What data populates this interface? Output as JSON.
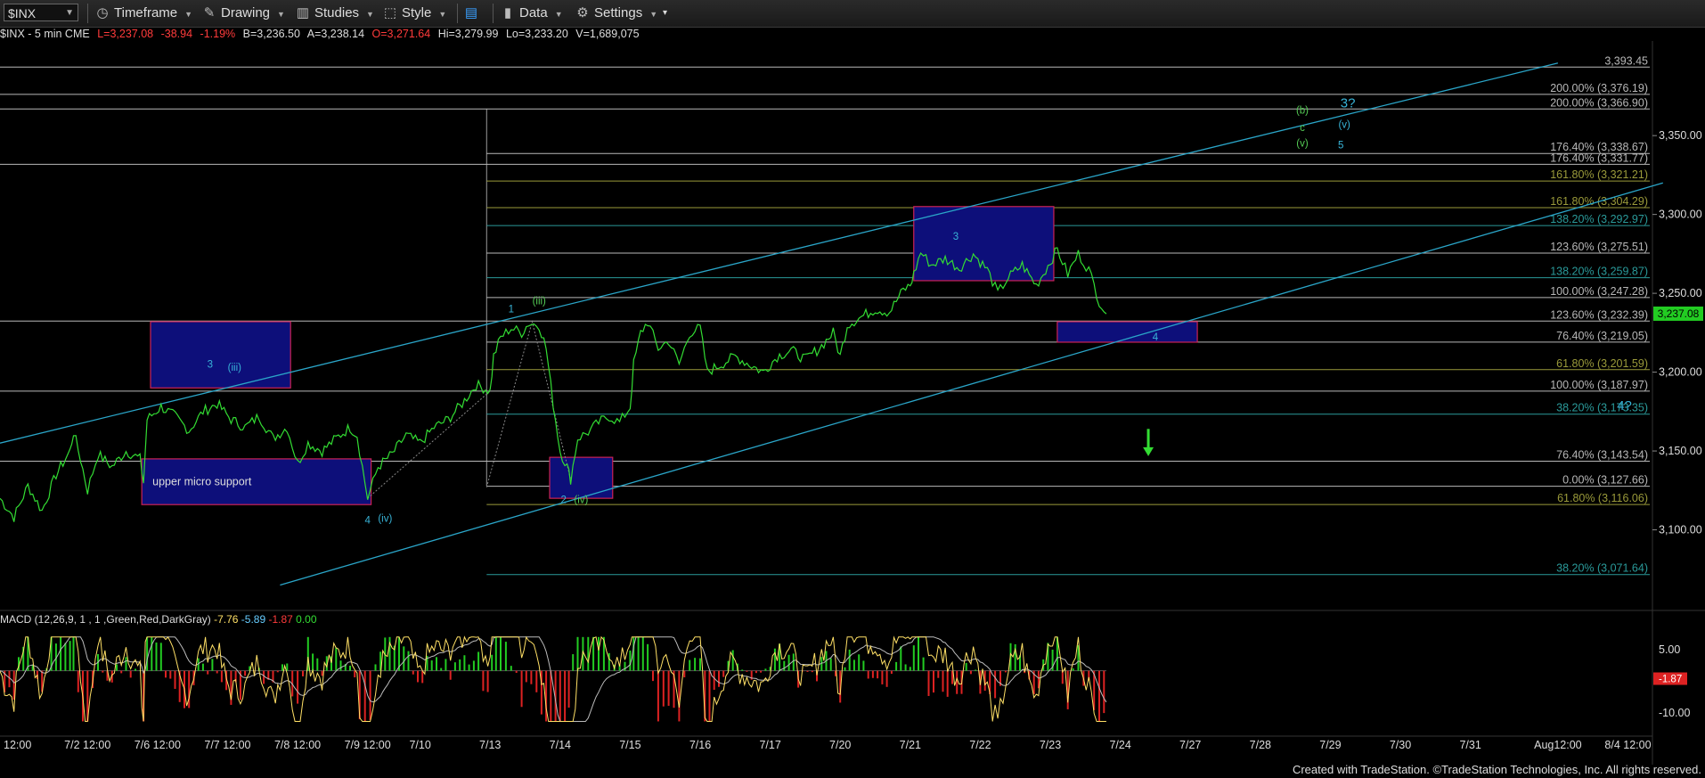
{
  "toolbar": {
    "symbol": "$INX",
    "timeframe": "Timeframe",
    "drawing": "Drawing",
    "studies": "Studies",
    "style": "Style",
    "data": "Data",
    "settings": "Settings"
  },
  "info": {
    "name": "$INX - 5 min  CME",
    "last": "L=3,237.08",
    "change": "-38.94",
    "change_pct": "-1.19%",
    "bid": "B=3,236.50",
    "ask": "A=3,238.14",
    "open": "O=3,271.64",
    "high": "Hi=3,279.99",
    "low": "Lo=3,233.20",
    "volume": "V=1,689,075"
  },
  "macd": {
    "label": "MACD (12,26,9, 1 , 1 ,Green,Red,DarkGray)",
    "v1": "-7.76",
    "v2": "-5.89",
    "v3": "-1.87",
    "v4": "0.00",
    "scale_top": "5.00",
    "scale_bottom": "-10.00",
    "current_tag": "-1.87"
  },
  "colors": {
    "price": "#33dd33",
    "channel": "#2aa5c8",
    "box_fill": "#0d0f7a",
    "box_border": "#cc2255",
    "fib_line": "#b8b8b8",
    "fib_olive": "#9a9a3a",
    "wave_cyan": "#38b4d8",
    "wave_green": "#55cc55",
    "macd_line": "#ffe066"
  },
  "chart_data": {
    "type": "line",
    "symbol": "$INX",
    "interval": "5 min",
    "y_axis": {
      "range": [
        3050,
        3410
      ],
      "ticks": [
        "3,100.00",
        "3,150.00",
        "3,200.00",
        "3,250.00",
        "3,300.00",
        "3,350.00"
      ],
      "tick_values": [
        3100,
        3150,
        3200,
        3250,
        3300,
        3350
      ]
    },
    "x_labels": [
      "12:00",
      "7/2 12:00",
      "7/6 12:00",
      "7/7 12:00",
      "7/8 12:00",
      "7/9 12:00",
      "7/10",
      "7/13",
      "7/14",
      "7/15",
      "7/16",
      "7/17",
      "7/20",
      "7/21",
      "7/22",
      "7/23",
      "7/24",
      "7/27",
      "7/28",
      "7/29",
      "7/30",
      "7/31",
      "Aug12:00",
      "8/4 12:00"
    ],
    "x_label_pos": [
      0.5,
      2.5,
      4.5,
      6.5,
      8.5,
      10.5,
      12,
      14,
      16,
      18,
      20,
      22,
      24,
      26,
      28,
      30,
      32,
      34,
      36,
      38,
      40,
      42,
      44.5,
      46.5
    ],
    "last_price": "3,237.08",
    "last_price_value": 3237.08,
    "series": [
      {
        "values": [
          {
            "x": 0,
            "y": 3120
          },
          {
            "x": 0.4,
            "y": 3108
          },
          {
            "x": 0.8,
            "y": 3128
          },
          {
            "x": 1.2,
            "y": 3112
          },
          {
            "x": 1.6,
            "y": 3135
          },
          {
            "x": 2,
            "y": 3150
          },
          {
            "x": 2.1,
            "y": 3162
          },
          {
            "x": 2.3,
            "y": 3145
          },
          {
            "x": 2.5,
            "y": 3125
          },
          {
            "x": 2.8,
            "y": 3148
          },
          {
            "x": 3.2,
            "y": 3140
          },
          {
            "x": 3.6,
            "y": 3150
          },
          {
            "x": 4,
            "y": 3145
          },
          {
            "x": 4.1,
            "y": 3130
          },
          {
            "x": 4.2,
            "y": 3170
          },
          {
            "x": 4.6,
            "y": 3178
          },
          {
            "x": 5,
            "y": 3172
          },
          {
            "x": 5.4,
            "y": 3163
          },
          {
            "x": 5.8,
            "y": 3175
          },
          {
            "x": 6.2,
            "y": 3180
          },
          {
            "x": 6.6,
            "y": 3170
          },
          {
            "x": 7,
            "y": 3165
          },
          {
            "x": 7.4,
            "y": 3172
          },
          {
            "x": 7.8,
            "y": 3158
          },
          {
            "x": 8.2,
            "y": 3165
          },
          {
            "x": 8.5,
            "y": 3142
          },
          {
            "x": 8.8,
            "y": 3155
          },
          {
            "x": 9.2,
            "y": 3150
          },
          {
            "x": 9.6,
            "y": 3158
          },
          {
            "x": 10,
            "y": 3165
          },
          {
            "x": 10.2,
            "y": 3160
          },
          {
            "x": 10.5,
            "y": 3120
          },
          {
            "x": 10.8,
            "y": 3140
          },
          {
            "x": 11.2,
            "y": 3148
          },
          {
            "x": 11.6,
            "y": 3160
          },
          {
            "x": 12,
            "y": 3155
          },
          {
            "x": 12.4,
            "y": 3165
          },
          {
            "x": 12.8,
            "y": 3170
          },
          {
            "x": 13.2,
            "y": 3180
          },
          {
            "x": 13.6,
            "y": 3192
          },
          {
            "x": 14,
            "y": 3188
          },
          {
            "x": 14.1,
            "y": 3210
          },
          {
            "x": 14.3,
            "y": 3222
          },
          {
            "x": 14.6,
            "y": 3228
          },
          {
            "x": 14.9,
            "y": 3225
          },
          {
            "x": 15.1,
            "y": 3231
          },
          {
            "x": 15.4,
            "y": 3230
          },
          {
            "x": 15.6,
            "y": 3215
          },
          {
            "x": 15.8,
            "y": 3180
          },
          {
            "x": 16,
            "y": 3150
          },
          {
            "x": 16.2,
            "y": 3140
          },
          {
            "x": 16.3,
            "y": 3132
          },
          {
            "x": 16.5,
            "y": 3158
          },
          {
            "x": 16.8,
            "y": 3162
          },
          {
            "x": 17.1,
            "y": 3168
          },
          {
            "x": 17.4,
            "y": 3172
          },
          {
            "x": 17.7,
            "y": 3168
          },
          {
            "x": 18,
            "y": 3178
          },
          {
            "x": 18.1,
            "y": 3205
          },
          {
            "x": 18.3,
            "y": 3225
          },
          {
            "x": 18.5,
            "y": 3232
          },
          {
            "x": 18.8,
            "y": 3215
          },
          {
            "x": 19.1,
            "y": 3220
          },
          {
            "x": 19.4,
            "y": 3205
          },
          {
            "x": 19.7,
            "y": 3225
          },
          {
            "x": 20,
            "y": 3228
          },
          {
            "x": 20.2,
            "y": 3200
          },
          {
            "x": 20.6,
            "y": 3205
          },
          {
            "x": 21,
            "y": 3210
          },
          {
            "x": 21.4,
            "y": 3205
          },
          {
            "x": 21.8,
            "y": 3200
          },
          {
            "x": 22.2,
            "y": 3210
          },
          {
            "x": 22.6,
            "y": 3214
          },
          {
            "x": 23,
            "y": 3208
          },
          {
            "x": 23.4,
            "y": 3215
          },
          {
            "x": 23.8,
            "y": 3225
          },
          {
            "x": 24,
            "y": 3210
          },
          {
            "x": 24.2,
            "y": 3230
          },
          {
            "x": 24.6,
            "y": 3235
          },
          {
            "x": 25,
            "y": 3240
          },
          {
            "x": 25.4,
            "y": 3238
          },
          {
            "x": 25.8,
            "y": 3252
          },
          {
            "x": 26,
            "y": 3255
          },
          {
            "x": 26.1,
            "y": 3262
          },
          {
            "x": 26.3,
            "y": 3276
          },
          {
            "x": 26.6,
            "y": 3268
          },
          {
            "x": 27,
            "y": 3272
          },
          {
            "x": 27.4,
            "y": 3266
          },
          {
            "x": 27.8,
            "y": 3275
          },
          {
            "x": 28.2,
            "y": 3265
          },
          {
            "x": 28.5,
            "y": 3250
          },
          {
            "x": 28.8,
            "y": 3260
          },
          {
            "x": 29.2,
            "y": 3268
          },
          {
            "x": 29.6,
            "y": 3255
          },
          {
            "x": 30,
            "y": 3270
          },
          {
            "x": 30.2,
            "y": 3278
          },
          {
            "x": 30.5,
            "y": 3262
          },
          {
            "x": 30.8,
            "y": 3275
          },
          {
            "x": 31.1,
            "y": 3265
          },
          {
            "x": 31.4,
            "y": 3245
          },
          {
            "x": 31.6,
            "y": 3237
          }
        ]
      }
    ],
    "horizontal_levels": [
      {
        "label": "3,393.45",
        "value": 3393.45,
        "color": "#b8b8b8"
      },
      {
        "label": "200.00% (3,376.19)",
        "value": 3376.19,
        "color": "#b8b8b8"
      },
      {
        "label": "200.00% (3,366.90)",
        "value": 3366.9,
        "color": "#b8b8b8"
      },
      {
        "label": "176.40% (3,338.67)",
        "value": 3338.67,
        "color": "#b8b8b8"
      },
      {
        "label": "176.40% (3,331.77)",
        "value": 3331.77,
        "color": "#b8b8b8"
      },
      {
        "label": "161.80% (3,321.21)",
        "value": 3321.21,
        "color": "#9a9a3a"
      },
      {
        "label": "161.80% (3,304.29)",
        "value": 3304.29,
        "color": "#9a9a3a"
      },
      {
        "label": "138.20% (3,292.97)",
        "value": 3292.97,
        "color": "#2a9a9a"
      },
      {
        "label": "123.60% (3,275.51)",
        "value": 3275.51,
        "color": "#b8b8b8"
      },
      {
        "label": "138.20% (3,259.87)",
        "value": 3259.87,
        "color": "#2a9a9a"
      },
      {
        "label": "100.00% (3,247.28)",
        "value": 3247.28,
        "color": "#b8b8b8"
      },
      {
        "label": "123.60% (3,232.39)",
        "value": 3232.39,
        "color": "#b8b8b8"
      },
      {
        "label": "76.40% (3,219.05)",
        "value": 3219.05,
        "color": "#b8b8b8"
      },
      {
        "label": "61.80% (3,201.59)",
        "value": 3201.59,
        "color": "#9a9a3a"
      },
      {
        "label": "100.00% (3,187.97)",
        "value": 3187.97,
        "color": "#b8b8b8"
      },
      {
        "label": "38.20% (3,173.35)",
        "value": 3173.35,
        "color": "#2a9a9a"
      },
      {
        "label": "76.40% (3,143.54)",
        "value": 3143.54,
        "color": "#b8b8b8"
      },
      {
        "label": "0.00% (3,127.66)",
        "value": 3127.66,
        "color": "#b8b8b8"
      },
      {
        "label": "61.80% (3,116.06)",
        "value": 3116.06,
        "color": "#9a9a3a"
      },
      {
        "label": "38.20% (3,071.64)",
        "value": 3071.64,
        "color": "#2a9a9a"
      }
    ],
    "boxes": [
      {
        "x0": 4.3,
        "x1": 8.3,
        "y0": 3190,
        "y1": 3232,
        "label": ""
      },
      {
        "x0": 4.05,
        "x1": 10.6,
        "y0": 3116,
        "y1": 3145,
        "label": "upper micro support"
      },
      {
        "x0": 15.7,
        "x1": 17.5,
        "y0": 3120,
        "y1": 3146,
        "label": ""
      },
      {
        "x0": 26.1,
        "x1": 30.1,
        "y0": 3258,
        "y1": 3305,
        "label": ""
      },
      {
        "x0": 30.2,
        "x1": 34.2,
        "y0": 3219,
        "y1": 3232,
        "label": ""
      }
    ],
    "channel_lines": [
      {
        "x0": 0,
        "y0": 3155,
        "x1": 44.5,
        "y1": 3396
      },
      {
        "x0": 8,
        "y0": 3065,
        "x1": 47.5,
        "y1": 3320
      }
    ],
    "wave_labels": [
      {
        "text": "3",
        "x": 6,
        "y": 3203,
        "color": "#38b4d8"
      },
      {
        "text": "(iii)",
        "x": 6.7,
        "y": 3201,
        "color": "#38b4d8"
      },
      {
        "text": "4",
        "x": 10.5,
        "y": 3104,
        "color": "#38b4d8"
      },
      {
        "text": "(iv)",
        "x": 11,
        "y": 3105,
        "color": "#38b4d8"
      },
      {
        "text": "1",
        "x": 14.6,
        "y": 3238,
        "color": "#38b4d8"
      },
      {
        "text": "(iii)",
        "x": 15.4,
        "y": 3243,
        "color": "#55cc55"
      },
      {
        "text": "2",
        "x": 16.1,
        "y": 3117,
        "color": "#38b4d8"
      },
      {
        "text": "(iv)",
        "x": 16.6,
        "y": 3117,
        "color": "#55cc55"
      },
      {
        "text": "3",
        "x": 27.3,
        "y": 3284,
        "color": "#38b4d8"
      },
      {
        "text": "4",
        "x": 33,
        "y": 3220,
        "color": "#38b4d8"
      },
      {
        "text": "(b)",
        "x": 37.2,
        "y": 3364,
        "color": "#55cc55"
      },
      {
        "text": "c",
        "x": 37.2,
        "y": 3353,
        "color": "#55cc55"
      },
      {
        "text": "(v)",
        "x": 37.2,
        "y": 3343,
        "color": "#55cc55"
      },
      {
        "text": "3?",
        "x": 38.5,
        "y": 3368,
        "color": "#38b4d8"
      },
      {
        "text": "(v)",
        "x": 38.4,
        "y": 3355,
        "color": "#38b4d8"
      },
      {
        "text": "5",
        "x": 38.3,
        "y": 3342,
        "color": "#38b4d8"
      },
      {
        "text": "4?",
        "x": 46.4,
        "y": 3176,
        "color": "#38b4d8"
      }
    ],
    "arrow": {
      "x": 32.8,
      "y0": 3164,
      "y1": 3149,
      "color": "#33dd33"
    }
  },
  "footer": "Created with TradeStation. ©TradeStation Technologies, Inc. All rights reserved."
}
